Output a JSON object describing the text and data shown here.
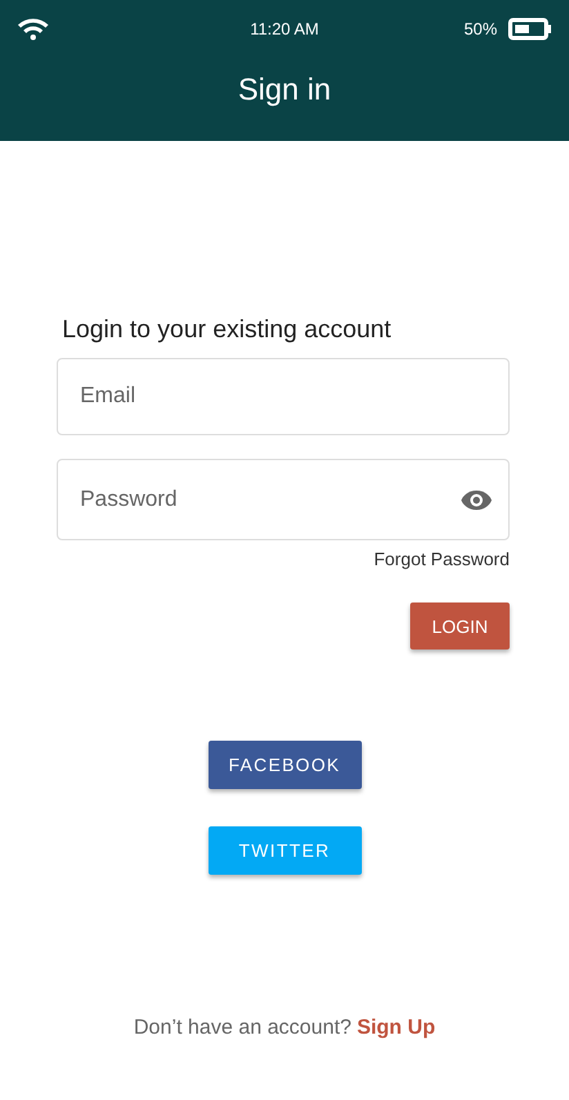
{
  "status_bar": {
    "time": "11:20 AM",
    "battery": "50%"
  },
  "app_bar": {
    "title": "Sign in"
  },
  "form": {
    "heading": "Login to your existing account",
    "email": {
      "placeholder": "Email"
    },
    "password": {
      "placeholder": "Password"
    },
    "forgot": "Forgot Password",
    "login": "LOGIN"
  },
  "social": [
    {
      "label": "FACEBOOK",
      "color": "#3b5998"
    },
    {
      "label": "TWITTER",
      "color": "#03a9f4"
    }
  ],
  "footer": {
    "text": "Don’t have an account?",
    "link": "Sign Up"
  }
}
